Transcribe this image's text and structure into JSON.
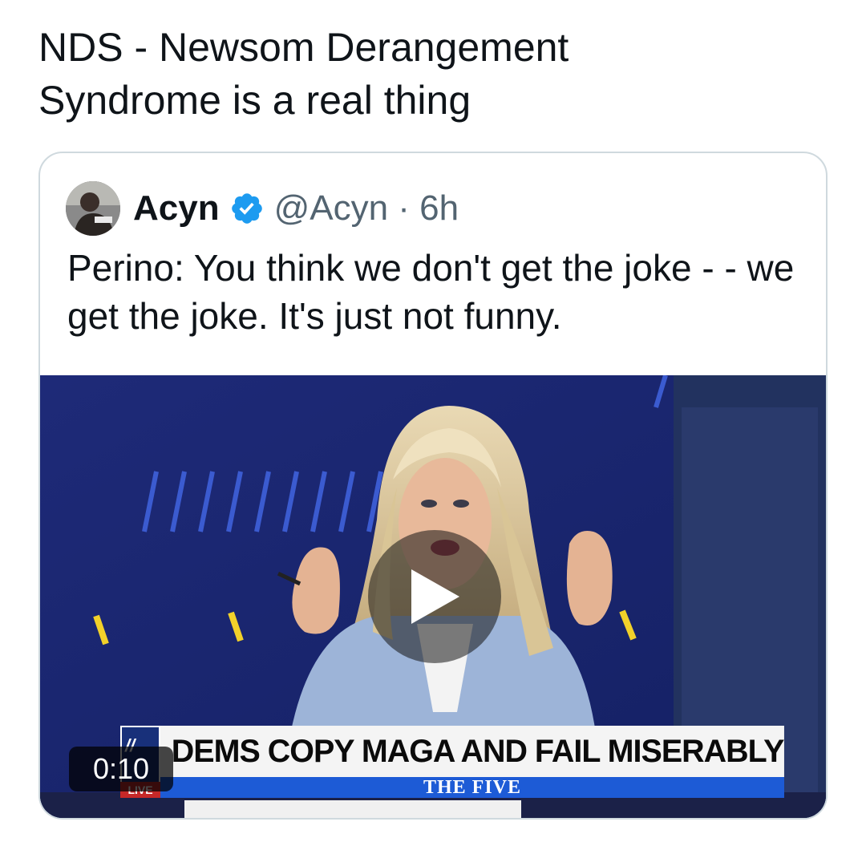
{
  "post": {
    "text": "NDS - Newsom Derangement Syndrome is a real thing"
  },
  "quoted_tweet": {
    "author_name": "Acyn",
    "verified": true,
    "meta": "@Acyn · 6h",
    "text": "Perino: You think we don't get the joke - - we get the joke. It's just not funny.",
    "media": {
      "type": "video",
      "duration": "0:10",
      "chyron_headline": "DEMS COPY MAGA AND FAIL MISERABLY",
      "chyron_show": "THE FIVE",
      "live_label": "LIVE"
    }
  },
  "colors": {
    "verified_badge": "#1d9bf0",
    "meta_text": "#536471",
    "border": "#cfd9de"
  }
}
